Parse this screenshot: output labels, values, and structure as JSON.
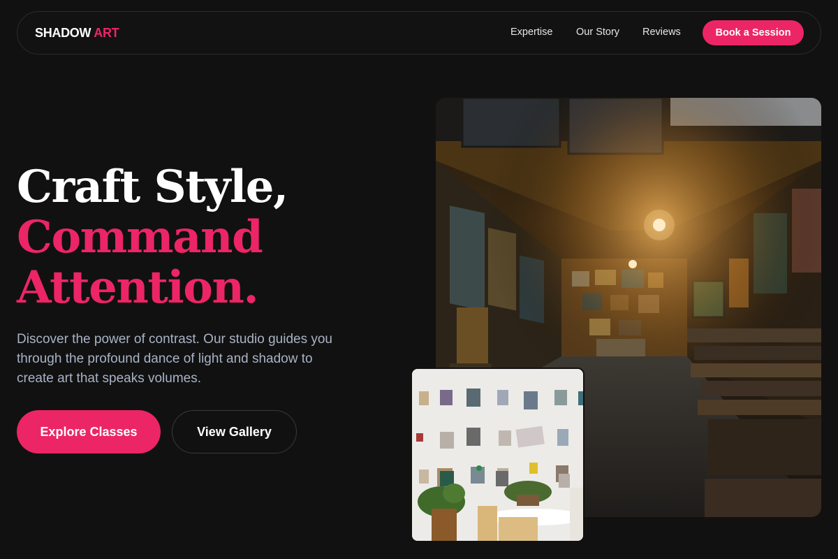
{
  "brand": {
    "word1": "SHADOW",
    "word2": "ART",
    "accent": "#ec2566"
  },
  "nav": {
    "links": [
      "Expertise",
      "Our Story",
      "Reviews"
    ],
    "cta": "Book a Session"
  },
  "hero": {
    "line1": "Craft Style,",
    "line2": "Command",
    "line3": "Attention.",
    "description": "Discover the power of contrast. Our studio guides you through the profound dance of light and shadow to create art that speaks volumes.",
    "primary_button": "Explore Classes",
    "secondary_button": "View Gallery"
  },
  "colors": {
    "background": "#111112",
    "accent": "#ec2566",
    "text_muted": "#a9b3c4"
  }
}
